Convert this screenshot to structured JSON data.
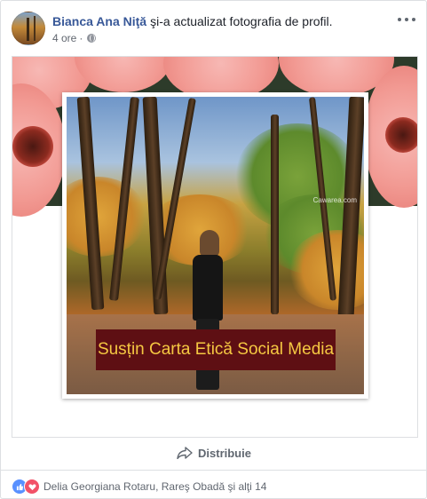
{
  "post": {
    "author": "Bianca Ana Niţă",
    "action": "şi-a actualizat fotografia de profil.",
    "time": "4 ore",
    "separator": "·"
  },
  "photo": {
    "banner_text": "Susțin Carta Etică Social Media",
    "watermark": "Cawarea.com"
  },
  "actions": {
    "share_label": "Distribuie"
  },
  "reactions": {
    "names": "Delia Georgiana Rotaru, Rareş Obadă şi alţi 14"
  },
  "icons": {
    "privacy": "globe-icon",
    "menu": "more-options-icon",
    "share": "share-arrow-icon",
    "like": "like-reaction-icon",
    "love": "love-reaction-icon"
  },
  "colors": {
    "author_link": "#385898",
    "banner_bg": "#5e0f13",
    "banner_text": "#f5c842",
    "like": "#5890ff",
    "love": "#f25268"
  }
}
